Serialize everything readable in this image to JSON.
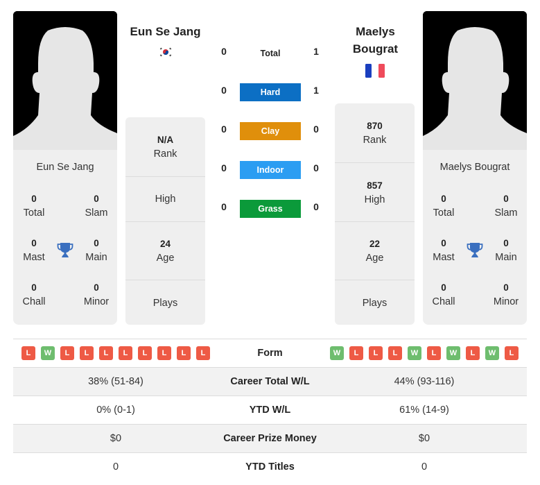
{
  "player_left": {
    "name": "Eun Se Jang",
    "card_name": "Eun Se Jang",
    "flag": "south-korea-flag",
    "titles": {
      "total": {
        "value": "0",
        "label": "Total"
      },
      "slam": {
        "value": "0",
        "label": "Slam"
      },
      "mast": {
        "value": "0",
        "label": "Mast"
      },
      "main": {
        "value": "0",
        "label": "Main"
      },
      "chall": {
        "value": "0",
        "label": "Chall"
      },
      "minor": {
        "value": "0",
        "label": "Minor"
      }
    },
    "stats": {
      "rank": {
        "value": "N/A",
        "label": "Rank"
      },
      "high": {
        "value": "",
        "label": "High"
      },
      "age": {
        "value": "24",
        "label": "Age"
      },
      "plays": {
        "value": "",
        "label": "Plays"
      }
    }
  },
  "player_right": {
    "name": "Maelys Bougrat",
    "name_line1": "Maelys",
    "name_line2": "Bougrat",
    "card_name": "Maelys Bougrat",
    "flag": "france-flag",
    "titles": {
      "total": {
        "value": "0",
        "label": "Total"
      },
      "slam": {
        "value": "0",
        "label": "Slam"
      },
      "mast": {
        "value": "0",
        "label": "Mast"
      },
      "main": {
        "value": "0",
        "label": "Main"
      },
      "chall": {
        "value": "0",
        "label": "Chall"
      },
      "minor": {
        "value": "0",
        "label": "Minor"
      }
    },
    "stats": {
      "rank": {
        "value": "870",
        "label": "Rank"
      },
      "high": {
        "value": "857",
        "label": "High"
      },
      "age": {
        "value": "22",
        "label": "Age"
      },
      "plays": {
        "value": "",
        "label": "Plays"
      }
    }
  },
  "h2h": {
    "total": {
      "label": "Total",
      "left": "0",
      "right": "1"
    },
    "surfaces": [
      {
        "label": "Hard",
        "left": "0",
        "right": "1",
        "color": "#0c6fc4"
      },
      {
        "label": "Clay",
        "left": "0",
        "right": "0",
        "color": "#e08f0b"
      },
      {
        "label": "Indoor",
        "left": "0",
        "right": "0",
        "color": "#2b9df2"
      },
      {
        "label": "Grass",
        "left": "0",
        "right": "0",
        "color": "#0b9a3a"
      }
    ]
  },
  "comparison": {
    "form": {
      "label": "Form",
      "left": [
        "L",
        "W",
        "L",
        "L",
        "L",
        "L",
        "L",
        "L",
        "L",
        "L"
      ],
      "right": [
        "W",
        "L",
        "L",
        "L",
        "W",
        "L",
        "W",
        "L",
        "W",
        "L"
      ]
    },
    "rows": [
      {
        "label": "Career Total W/L",
        "left": "38% (51-84)",
        "right": "44% (93-116)"
      },
      {
        "label": "YTD W/L",
        "left": "0% (0-1)",
        "right": "61% (14-9)"
      },
      {
        "label": "Career Prize Money",
        "left": "$0",
        "right": "$0"
      },
      {
        "label": "YTD Titles",
        "left": "0",
        "right": "0"
      }
    ]
  },
  "colors": {
    "loss": "#ee5a45",
    "win": "#6ebd6e",
    "trophy": "#3a6fbf"
  }
}
